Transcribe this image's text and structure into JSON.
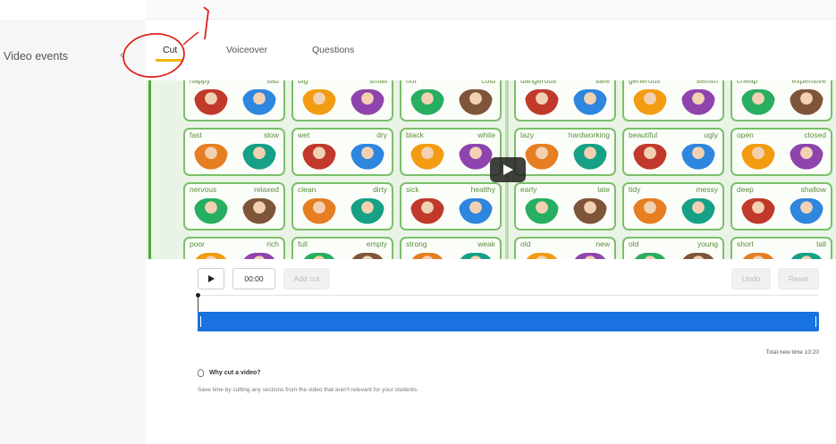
{
  "sidebar": {
    "title": "Video events"
  },
  "tabs": [
    {
      "label": "Cut",
      "active": true
    },
    {
      "label": "Voiceover",
      "active": false
    },
    {
      "label": "Questions",
      "active": false
    }
  ],
  "video": {
    "cards_left": [
      [
        "happy",
        "sad"
      ],
      [
        "big",
        "small"
      ],
      [
        "hot",
        "cold"
      ],
      [
        "fast",
        "slow"
      ],
      [
        "wet",
        "dry"
      ],
      [
        "black",
        "white"
      ],
      [
        "nervous",
        "relaxed"
      ],
      [
        "clean",
        "dirty"
      ],
      [
        "sick",
        "healthy"
      ],
      [
        "poor",
        "rich"
      ],
      [
        "full",
        "empty"
      ],
      [
        "strong",
        "weak"
      ]
    ],
    "cards_right": [
      [
        "dangerous",
        "safe"
      ],
      [
        "generous",
        "selfish"
      ],
      [
        "cheap",
        "expensive"
      ],
      [
        "lazy",
        "hardworking"
      ],
      [
        "beautiful",
        "ugly"
      ],
      [
        "open",
        "closed"
      ],
      [
        "early",
        "late"
      ],
      [
        "tidy",
        "messy"
      ],
      [
        "deep",
        "shallow"
      ],
      [
        "old",
        "new"
      ],
      [
        "old",
        "young"
      ],
      [
        "short",
        "tall"
      ]
    ]
  },
  "controls": {
    "time": "00:00",
    "add_cut": "Add cut",
    "undo": "Undo",
    "reset": "Reset"
  },
  "timeline": {
    "total_label": "Total new time 10:20"
  },
  "help": {
    "title": "Why cut a video?",
    "text": "Save time by cutting any sections from the video that aren't relevant for your students."
  },
  "annotation": {
    "number": "1",
    "color": "#e0221a"
  }
}
